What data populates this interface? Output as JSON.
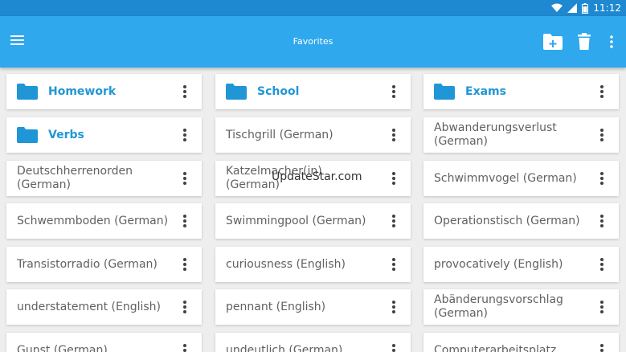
{
  "status_bar": {
    "time": "11:12"
  },
  "app_bar": {
    "title": "Favorites"
  },
  "watermark": "UpdateStar.com",
  "items": [
    {
      "label": "Homework",
      "folder": true
    },
    {
      "label": "School",
      "folder": true
    },
    {
      "label": "Exams",
      "folder": true
    },
    {
      "label": "Verbs",
      "folder": true
    },
    {
      "label": "Tischgrill (German)",
      "folder": false
    },
    {
      "label": "Abwanderungsverlust (German)",
      "folder": false
    },
    {
      "label": "Deutschherrenorden (German)",
      "folder": false
    },
    {
      "label": "Katzelmacher(in) (German)",
      "folder": false
    },
    {
      "label": "Schwimmvogel (German)",
      "folder": false
    },
    {
      "label": "Schwemmboden (German)",
      "folder": false
    },
    {
      "label": "Swimmingpool (German)",
      "folder": false
    },
    {
      "label": "Operationstisch (German)",
      "folder": false
    },
    {
      "label": "Transistorradio (German)",
      "folder": false
    },
    {
      "label": "curiousness (English)",
      "folder": false
    },
    {
      "label": "provocatively (English)",
      "folder": false
    },
    {
      "label": "understatement (English)",
      "folder": false
    },
    {
      "label": "pennant (English)",
      "folder": false
    },
    {
      "label": "Abänderungsvorschlag (German)",
      "folder": false
    },
    {
      "label": "Gunst (German)",
      "folder": false
    },
    {
      "label": "undeutlich (German)",
      "folder": false
    },
    {
      "label": "Computerarbeitsplatz",
      "folder": false
    }
  ],
  "colors": {
    "status_bar": "#1e88d1",
    "app_bar": "#2fa8ee",
    "folder": "#2196d6"
  }
}
